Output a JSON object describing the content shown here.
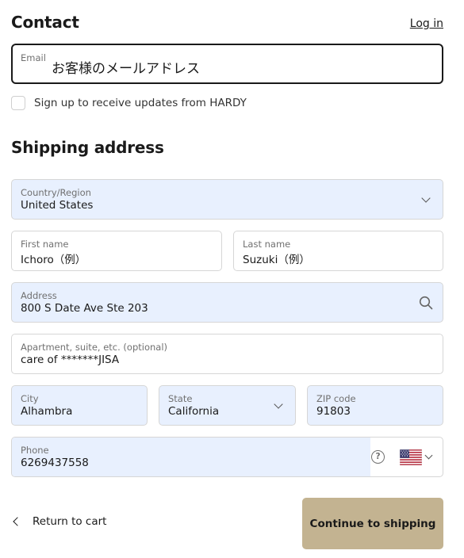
{
  "contact": {
    "title": "Contact",
    "login_label": "Log in",
    "email_label": "Email",
    "email_value": "お客様のメールアドレス",
    "newsletter_label": "Sign up to receive updates from HARDY"
  },
  "shipping": {
    "title": "Shipping address",
    "country": {
      "label": "Country/Region",
      "value": "United States"
    },
    "first_name": {
      "label": "First name",
      "value": "Ichoro（例）"
    },
    "last_name": {
      "label": "Last name",
      "value": "Suzuki（例）"
    },
    "address": {
      "label": "Address",
      "value": "800 S Date Ave Ste 203"
    },
    "apartment": {
      "label": "Apartment, suite, etc. (optional)",
      "value": "care of *******JISA"
    },
    "city": {
      "label": "City",
      "value": "Alhambra"
    },
    "state": {
      "label": "State",
      "value": "California"
    },
    "zip": {
      "label": "ZIP code",
      "value": "91803"
    },
    "phone": {
      "label": "Phone",
      "value": "6269437558",
      "help_glyph": "?",
      "country_flag": "us-flag-icon"
    }
  },
  "footer": {
    "return_label": "Return to cart",
    "continue_label": "Continue to shipping"
  },
  "colors": {
    "autofill_background": "#e8f0fe",
    "continue_button": "#c3b391",
    "text": "#1a1a1a",
    "muted_label": "#707070"
  }
}
